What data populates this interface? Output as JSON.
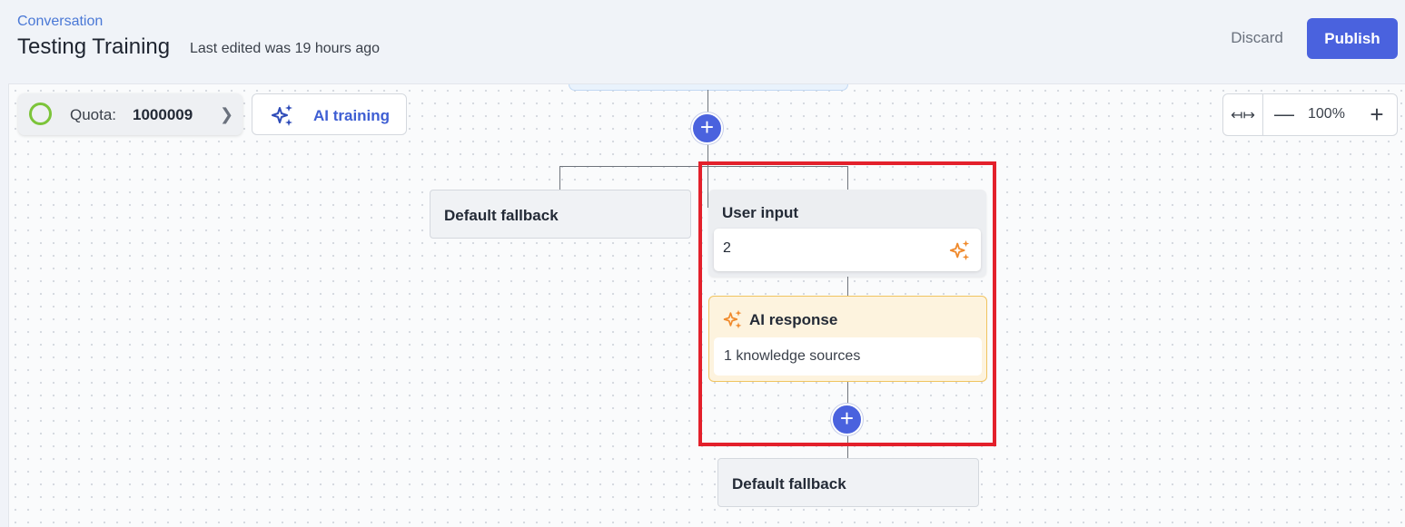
{
  "header": {
    "breadcrumb": "Conversation",
    "title": "Testing Training",
    "last_edited": "Last edited was 19 hours ago",
    "discard_label": "Discard",
    "publish_label": "Publish"
  },
  "toolbar": {
    "quota_label": "Quota:",
    "quota_value": "1000009",
    "ai_training_label": "AI training"
  },
  "zoom": {
    "fit_icon": "↤↦",
    "level": "100%"
  },
  "flow": {
    "fallback_left_label": "Default fallback",
    "user_input_title": "User input",
    "user_input_value": "2",
    "ai_response_title": "AI response",
    "ai_response_sources": "1 knowledge sources",
    "fallback_bottom_label": "Default fallback"
  },
  "icons": {
    "quota": "progress-ring-icon",
    "chevron": "chevron-right-icon",
    "ai_training": "sparkle-icon",
    "user_input_sparkle": "sparkle-icon",
    "ai_response_sparkle": "sparkle-icon",
    "add": "plus-icon"
  },
  "colors": {
    "accent": "#4a62de",
    "quota_ring": "#7cc43a",
    "sparkle": "#f08a2c",
    "ai_card_bg": "#fdf3de",
    "ai_card_border": "#f0c460",
    "highlight": "#e3202b"
  }
}
